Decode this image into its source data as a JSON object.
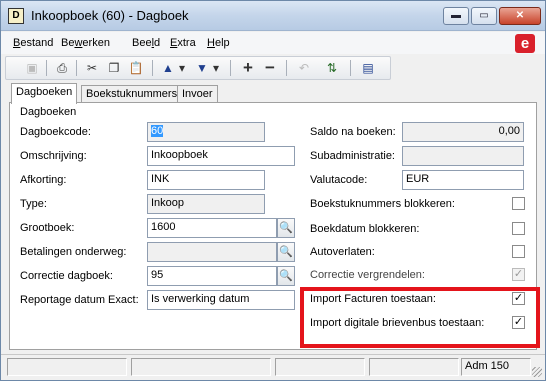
{
  "window": {
    "title": "Inkoopboek (60) - Dagboek",
    "app_icon": "D",
    "min_glyph": "▬",
    "max_glyph": "▭",
    "close_glyph": "✕"
  },
  "menu": {
    "items": [
      {
        "key": "B",
        "rest": "estand"
      },
      {
        "key": "",
        "pre": "Be",
        "keymid": "w",
        "rest": "erken"
      },
      {
        "key": "",
        "pre": "Bee",
        "keymid": "l",
        "rest": "d"
      },
      {
        "key": "E",
        "rest": "xtra"
      },
      {
        "key": "H",
        "rest": "elp"
      }
    ],
    "labels": [
      "Bestand",
      "Bewerken",
      "Beeld",
      "Extra",
      "Help"
    ],
    "brand_logo": "e"
  },
  "toolbar": {
    "icons": [
      "save-icon",
      "print-icon",
      "cut-icon",
      "copy-icon",
      "paste-icon",
      "arrow-up-icon",
      "arrow-down-icon",
      "add-icon",
      "remove-icon",
      "undo-icon",
      "refresh-icon",
      "layout-icon"
    ],
    "glyphs": {
      "save": "▣",
      "print": "⎙",
      "cut": "✂",
      "copy": "❐",
      "paste": "📋",
      "up": "▲",
      "down": "▼",
      "dropdown": "▾",
      "add": "+",
      "remove": "−",
      "undo": "↶",
      "refresh": "⇅",
      "layout": "▤"
    }
  },
  "tabs": [
    "Dagboeken",
    "Boekstuknummers",
    "Invoer"
  ],
  "group": {
    "label": "Dagboeken"
  },
  "left_fields": {
    "dagboekcode": {
      "label": "Dagboekcode:",
      "value": "60"
    },
    "omschrijving": {
      "label": "Omschrijving:",
      "value": "Inkoopboek"
    },
    "afkorting": {
      "label": "Afkorting:",
      "value": "INK"
    },
    "type": {
      "label": "Type:",
      "value": "Inkoop"
    },
    "grootboek": {
      "label": "Grootboek:",
      "value": "1600"
    },
    "betalingen": {
      "label": "Betalingen onderweg:",
      "value": ""
    },
    "correctie": {
      "label": "Correctie dagboek:",
      "value": "95"
    },
    "reportage": {
      "label": "Reportage datum Exact:",
      "value": "Is verwerking datum"
    }
  },
  "right_fields": {
    "saldo": {
      "label": "Saldo na boeken:",
      "value": "0,00"
    },
    "subadmin": {
      "label": "Subadministratie:",
      "value": ""
    },
    "valuta": {
      "label": "Valutacode:",
      "value": "EUR"
    },
    "bsn_blok": {
      "label": "Boekstuknummers blokkeren:",
      "checked": ""
    },
    "bdat_blok": {
      "label": "Boekdatum blokkeren:",
      "checked": ""
    },
    "autoverlaten": {
      "label": "Autoverlaten:",
      "checked": ""
    },
    "corr_vergr": {
      "label": "Correctie vergrendelen:",
      "checked": "✓"
    },
    "import_fact": {
      "label": "Import Facturen toestaan:",
      "checked": "✓"
    },
    "import_brief": {
      "label": "Import digitale brievenbus toestaan:",
      "checked": "✓"
    }
  },
  "lookup_glyph": "🔍",
  "status": {
    "user": "Adm 150"
  },
  "colors": {
    "highlight": "#e4141b",
    "brand": "#d9202b",
    "selection": "#3399ff"
  }
}
